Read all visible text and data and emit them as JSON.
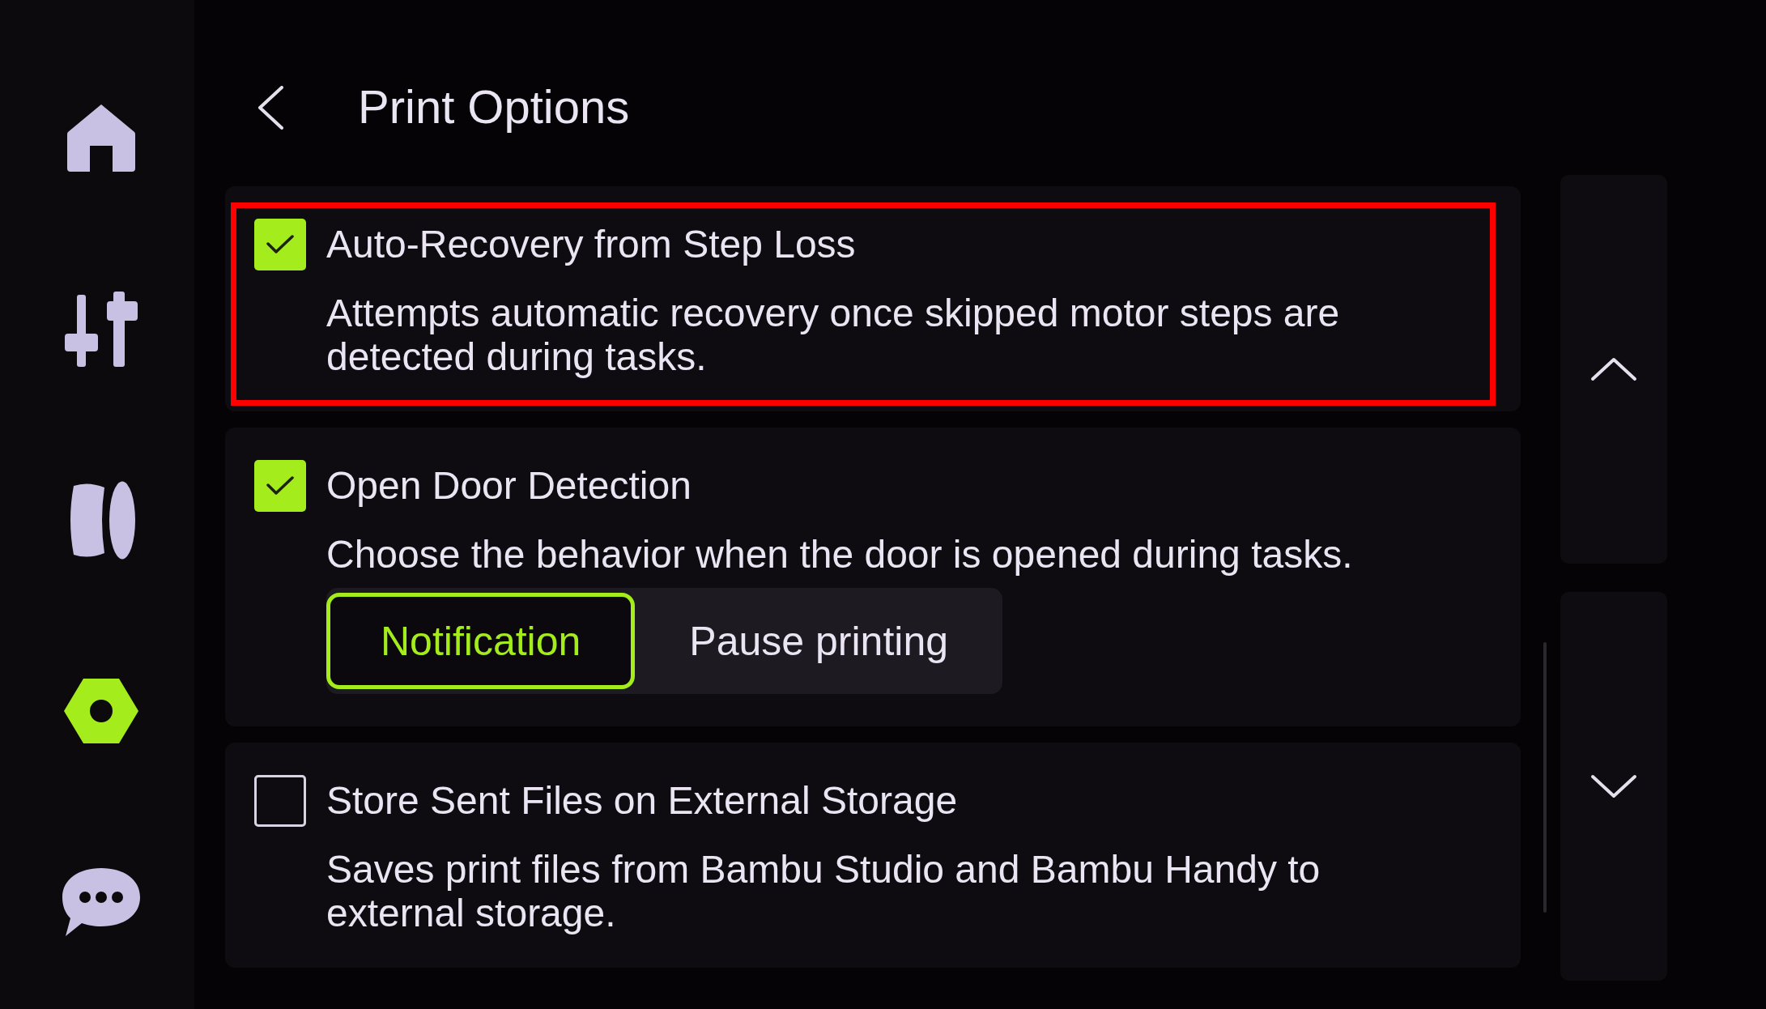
{
  "sidebar": {
    "items": [
      {
        "kind": "home",
        "selected": false
      },
      {
        "kind": "sliders",
        "selected": false
      },
      {
        "kind": "spool",
        "selected": false
      },
      {
        "kind": "settings",
        "selected": true
      },
      {
        "kind": "chat",
        "selected": false
      }
    ]
  },
  "header": {
    "title": "Print Options"
  },
  "options": [
    {
      "title": "Auto-Recovery from Step Loss",
      "description": "Attempts automatic recovery once skipped motor steps are detected during tasks.",
      "checked": true,
      "highlighted": true
    },
    {
      "title": "Open Door Detection",
      "description": "Choose the behavior when the door is opened during tasks.",
      "checked": true,
      "highlighted": false,
      "choices": [
        {
          "label": "Notification",
          "selected": true
        },
        {
          "label": "Pause printing",
          "selected": false
        }
      ]
    },
    {
      "title": "Store Sent Files on External Storage",
      "description": "Saves print files from Bambu Studio and Bambu Handy to external storage.",
      "checked": false,
      "highlighted": false
    }
  ]
}
